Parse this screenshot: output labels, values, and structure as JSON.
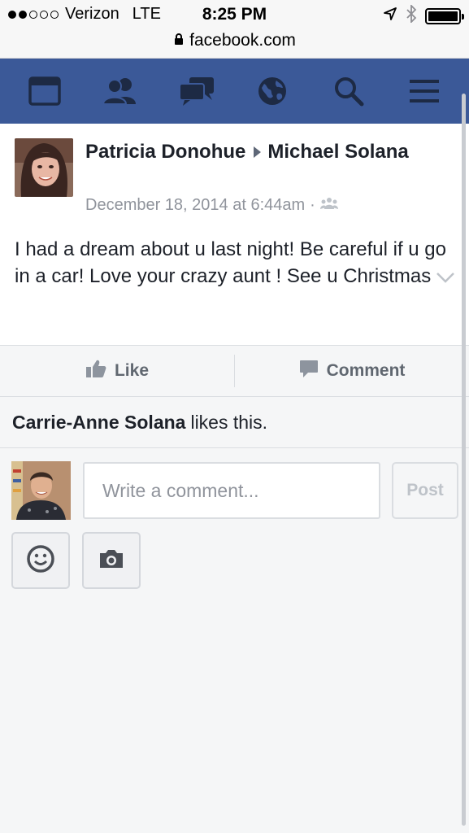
{
  "status_bar": {
    "carrier": "Verizon",
    "network": "LTE",
    "time": "8:25 PM",
    "url": "facebook.com",
    "signal_bars_filled": 2,
    "signal_bars_total": 5,
    "icons": [
      "location-arrow-icon",
      "bluetooth-icon",
      "battery-icon"
    ]
  },
  "navbar": {
    "bg_color": "#3b5998",
    "items": [
      "news-feed-icon",
      "friends-icon",
      "messages-icon",
      "notifications-globe-icon",
      "search-icon",
      "menu-icon"
    ]
  },
  "post": {
    "author": "Patricia Donohue",
    "recipient": "Michael Solana",
    "timestamp": "December 18, 2014 at 6:44am",
    "separator": "·",
    "privacy_icon": "friends-audience-icon",
    "text": "I had a dream about u last night! Be careful if u go in a car! Love your crazy aunt ! See u Christmas"
  },
  "actions": {
    "like_label": "Like",
    "comment_label": "Comment"
  },
  "likes": {
    "name": "Carrie-Anne Solana",
    "suffix": "likes this."
  },
  "composer": {
    "placeholder": "Write a comment...",
    "post_label": "Post",
    "tools": [
      "emoji-icon",
      "camera-icon"
    ]
  }
}
